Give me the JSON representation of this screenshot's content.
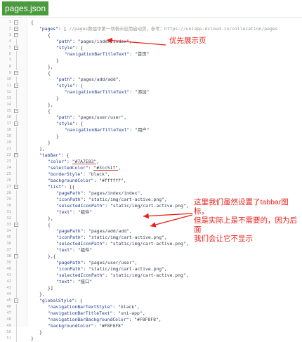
{
  "file_tab": {
    "label": "pages.json"
  },
  "annotations": {
    "first_page": "优先展示页",
    "tabbar_note": [
      "这里我们虽然设置了tabbar图标，",
      "但是实际上是不需要的，因为后面",
      "我们会让它不显示"
    ]
  },
  "colors": {
    "tab_bg": "#4a9a3e",
    "arrow": "#e8201a",
    "text_red": "#e8201a"
  },
  "code_lines": [
    {
      "fold": "minus",
      "segs": [
        [
          "p",
          "{"
        ]
      ]
    },
    {
      "fold": "minus",
      "segs": [
        [
          "p",
          "\t"
        ],
        [
          "k",
          "\"pages\""
        ],
        [
          "p",
          ": [ "
        ],
        [
          "c",
          "//pages数组中第一项表示应用启动页，参考：https://uniapp.dcloud.io/collocation/pages"
        ]
      ]
    },
    {
      "fold": "minus",
      "segs": [
        [
          "p",
          "\t\t{"
        ]
      ]
    },
    {
      "fold": "",
      "segs": [
        [
          "p",
          "\t\t\t"
        ],
        [
          "k",
          "\"path\""
        ],
        [
          "p",
          ": "
        ],
        [
          "s",
          "\"pages/index/index\""
        ],
        [
          "p",
          ","
        ]
      ]
    },
    {
      "fold": "minus",
      "segs": [
        [
          "p",
          "\t\t\t"
        ],
        [
          "k",
          "\"style\""
        ],
        [
          "p",
          ": {"
        ]
      ]
    },
    {
      "fold": "",
      "segs": [
        [
          "p",
          "\t\t\t\t"
        ],
        [
          "k",
          "\"navigationBarTitleText\""
        ],
        [
          "p",
          ": "
        ],
        [
          "s",
          "\"首页\""
        ]
      ]
    },
    {
      "fold": "",
      "segs": [
        [
          "p",
          "\t\t\t}"
        ]
      ]
    },
    {
      "fold": "",
      "segs": [
        [
          "p",
          "\t\t},"
        ]
      ]
    },
    {
      "fold": "minus",
      "segs": [
        [
          "p",
          "\t\t{"
        ]
      ]
    },
    {
      "fold": "",
      "segs": [
        [
          "p",
          "\t\t\t"
        ],
        [
          "k",
          "\"path\""
        ],
        [
          "p",
          ": "
        ],
        [
          "s",
          "\"pages/add/add\""
        ],
        [
          "p",
          ","
        ]
      ]
    },
    {
      "fold": "minus",
      "segs": [
        [
          "p",
          "\t\t\t"
        ],
        [
          "k",
          "\"style\""
        ],
        [
          "p",
          ": {"
        ]
      ]
    },
    {
      "fold": "",
      "segs": [
        [
          "p",
          "\t\t\t\t"
        ],
        [
          "k",
          "\"navigationBarTitleText\""
        ],
        [
          "p",
          ": "
        ],
        [
          "s",
          "\"添加\""
        ]
      ]
    },
    {
      "fold": "",
      "segs": [
        [
          "p",
          "\t\t\t}"
        ]
      ]
    },
    {
      "fold": "",
      "segs": [
        [
          "p",
          "\t\t},"
        ]
      ]
    },
    {
      "fold": "minus",
      "segs": [
        [
          "p",
          "\t\t{"
        ]
      ]
    },
    {
      "fold": "",
      "segs": [
        [
          "p",
          "\t\t\t"
        ],
        [
          "k",
          "\"path\""
        ],
        [
          "p",
          ": "
        ],
        [
          "s",
          "\"pages/user/user\""
        ],
        [
          "p",
          ","
        ]
      ]
    },
    {
      "fold": "minus",
      "segs": [
        [
          "p",
          "\t\t\t"
        ],
        [
          "k",
          "\"style\""
        ],
        [
          "p",
          ": {"
        ]
      ]
    },
    {
      "fold": "",
      "segs": [
        [
          "p",
          "\t\t\t\t"
        ],
        [
          "k",
          "\"navigationBarTitleText\""
        ],
        [
          "p",
          ": "
        ],
        [
          "s",
          "\"用户\""
        ]
      ]
    },
    {
      "fold": "",
      "segs": [
        [
          "p",
          "\t\t\t}"
        ]
      ]
    },
    {
      "fold": "",
      "segs": [
        [
          "p",
          "\t\t}"
        ]
      ]
    },
    {
      "fold": "",
      "segs": [
        [
          "p",
          "\t],"
        ]
      ]
    },
    {
      "fold": "minus",
      "segs": [
        [
          "p",
          "\t"
        ],
        [
          "k",
          "\"tabBar\""
        ],
        [
          "p",
          ": {"
        ]
      ]
    },
    {
      "fold": "",
      "segs": [
        [
          "p",
          "\t\t"
        ],
        [
          "k",
          "\"color\""
        ],
        [
          "p",
          ": "
        ],
        [
          "h",
          "\"#7A7E83\""
        ],
        [
          "p",
          ","
        ]
      ]
    },
    {
      "fold": "",
      "segs": [
        [
          "p",
          "\t\t"
        ],
        [
          "k",
          "\"selectedColor\""
        ],
        [
          "p",
          ": "
        ],
        [
          "h",
          "\"#3cc51f\""
        ],
        [
          "p",
          ","
        ]
      ]
    },
    {
      "fold": "",
      "segs": [
        [
          "p",
          "\t\t"
        ],
        [
          "k",
          "\"borderStyle\""
        ],
        [
          "p",
          ": "
        ],
        [
          "s",
          "\"black\""
        ],
        [
          "p",
          ","
        ]
      ]
    },
    {
      "fold": "",
      "segs": [
        [
          "p",
          "\t\t"
        ],
        [
          "k",
          "\"backgroundColor\""
        ],
        [
          "p",
          ": "
        ],
        [
          "s",
          "\"#ffffff\""
        ],
        [
          "p",
          ","
        ]
      ]
    },
    {
      "fold": "minus",
      "segs": [
        [
          "p",
          "\t\t"
        ],
        [
          "k",
          "\"list\""
        ],
        [
          "p",
          ": [{"
        ]
      ]
    },
    {
      "fold": "",
      "segs": [
        [
          "p",
          "\t\t\t"
        ],
        [
          "k",
          "\"pagePath\""
        ],
        [
          "p",
          ": "
        ],
        [
          "s",
          "\"pages/index/index\""
        ],
        [
          "p",
          ","
        ]
      ]
    },
    {
      "fold": "",
      "segs": [
        [
          "p",
          "\t\t\t"
        ],
        [
          "k",
          "\"iconPath\""
        ],
        [
          "p",
          ": "
        ],
        [
          "s",
          "\"static/img/cart-active.png\""
        ],
        [
          "p",
          ","
        ]
      ]
    },
    {
      "fold": "",
      "segs": [
        [
          "p",
          "\t\t\t"
        ],
        [
          "k",
          "\"selectedIconPath\""
        ],
        [
          "p",
          ": "
        ],
        [
          "s",
          "\"static/img/cart-active.png\""
        ],
        [
          "p",
          ","
        ]
      ]
    },
    {
      "fold": "",
      "segs": [
        [
          "p",
          "\t\t\t"
        ],
        [
          "k",
          "\"text\""
        ],
        [
          "p",
          ": "
        ],
        [
          "s",
          "\"组件\""
        ]
      ]
    },
    {
      "fold": "",
      "segs": [
        [
          "p",
          "\t\t},"
        ]
      ]
    },
    {
      "fold": "minus",
      "segs": [
        [
          "p",
          "\t\t{"
        ]
      ]
    },
    {
      "fold": "",
      "segs": [
        [
          "p",
          "\t\t\t"
        ],
        [
          "k",
          "\"pagePath\""
        ],
        [
          "p",
          ": "
        ],
        [
          "s",
          "\"pages/add/add\""
        ],
        [
          "p",
          ","
        ]
      ]
    },
    {
      "fold": "",
      "segs": [
        [
          "p",
          "\t\t\t"
        ],
        [
          "k",
          "\"iconPath\""
        ],
        [
          "p",
          ": "
        ],
        [
          "s",
          "\"static/img/cart-active.png\""
        ],
        [
          "p",
          ","
        ]
      ]
    },
    {
      "fold": "",
      "segs": [
        [
          "p",
          "\t\t\t"
        ],
        [
          "k",
          "\"selectedIconPath\""
        ],
        [
          "p",
          ": "
        ],
        [
          "s",
          "\"static/img/cart-active.png\""
        ],
        [
          "p",
          ","
        ]
      ]
    },
    {
      "fold": "",
      "segs": [
        [
          "p",
          "\t\t\t"
        ],
        [
          "k",
          "\"text\""
        ],
        [
          "p",
          ": "
        ],
        [
          "s",
          "\"组件\""
        ]
      ]
    },
    {
      "fold": "minus",
      "segs": [
        [
          "p",
          "\t\t},{"
        ]
      ]
    },
    {
      "fold": "",
      "segs": [
        [
          "p",
          "\t\t\t"
        ],
        [
          "k",
          "\"pagePath\""
        ],
        [
          "p",
          ": "
        ],
        [
          "s",
          "\"pages/user/user\""
        ],
        [
          "p",
          ","
        ]
      ]
    },
    {
      "fold": "",
      "segs": [
        [
          "p",
          "\t\t\t"
        ],
        [
          "k",
          "\"iconPath\""
        ],
        [
          "p",
          ": "
        ],
        [
          "s",
          "\"static/img/cart-active.png\""
        ],
        [
          "p",
          ","
        ]
      ]
    },
    {
      "fold": "",
      "segs": [
        [
          "p",
          "\t\t\t"
        ],
        [
          "k",
          "\"selectedIconPath\""
        ],
        [
          "p",
          ": "
        ],
        [
          "s",
          "\"static/img/cart-active.png\""
        ],
        [
          "p",
          ","
        ]
      ]
    },
    {
      "fold": "",
      "segs": [
        [
          "p",
          "\t\t\t"
        ],
        [
          "k",
          "\"text\""
        ],
        [
          "p",
          ": "
        ],
        [
          "s",
          "\"接口\""
        ]
      ]
    },
    {
      "fold": "",
      "segs": [
        [
          "p",
          "\t\t}]"
        ]
      ]
    },
    {
      "fold": "",
      "segs": [
        [
          "p",
          "\t},"
        ]
      ]
    },
    {
      "fold": "minus",
      "segs": [
        [
          "p",
          "\t"
        ],
        [
          "k",
          "\"globalStyle\""
        ],
        [
          "p",
          ": {"
        ]
      ]
    },
    {
      "fold": "",
      "segs": [
        [
          "p",
          "\t\t"
        ],
        [
          "k",
          "\"navigationBarTextStyle\""
        ],
        [
          "p",
          ": "
        ],
        [
          "s",
          "\"black\""
        ],
        [
          "p",
          ","
        ]
      ]
    },
    {
      "fold": "",
      "segs": [
        [
          "p",
          "\t\t"
        ],
        [
          "k",
          "\"navigationBarTitleText\""
        ],
        [
          "p",
          ": "
        ],
        [
          "s",
          "\"uni-app\""
        ],
        [
          "p",
          ","
        ]
      ]
    },
    {
      "fold": "",
      "segs": [
        [
          "p",
          "\t\t"
        ],
        [
          "k",
          "\"navigationBarBackgroundColor\""
        ],
        [
          "p",
          ": "
        ],
        [
          "s",
          "\"#F8F8F8\""
        ],
        [
          "p",
          ","
        ]
      ]
    },
    {
      "fold": "",
      "segs": [
        [
          "p",
          "\t\t"
        ],
        [
          "k",
          "\"backgroundColor\""
        ],
        [
          "p",
          ": "
        ],
        [
          "s",
          "\"#F8F8F8\""
        ]
      ]
    },
    {
      "fold": "",
      "segs": [
        [
          "p",
          "\t}"
        ]
      ]
    },
    {
      "fold": "",
      "segs": [
        [
          "p",
          "}"
        ]
      ]
    }
  ]
}
